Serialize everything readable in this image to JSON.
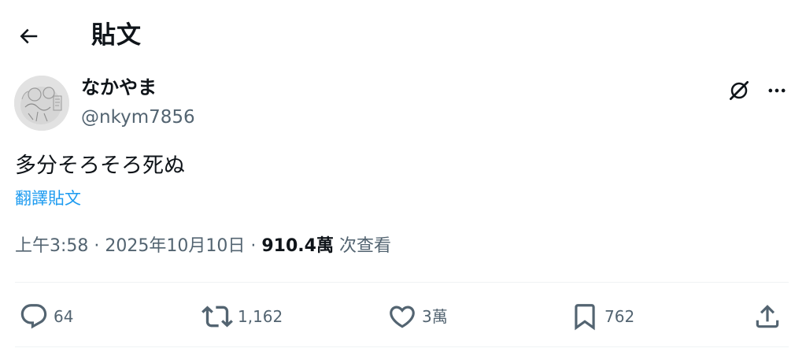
{
  "header": {
    "title": "貼文"
  },
  "author": {
    "display_name": "なかやま",
    "handle": "@nkym7856"
  },
  "tweet": {
    "text": "多分そろそろ死ぬ",
    "translate_label": "翻譯貼文"
  },
  "meta": {
    "time": "上午3:58",
    "separator": " · ",
    "date": "2025年10月10日",
    "views_count": "910.4萬",
    "views_label": "次查看"
  },
  "actions": {
    "replies": "64",
    "reposts": "1,162",
    "likes": "3萬",
    "bookmarks": "762"
  },
  "icons": {
    "back": "arrow-left-icon",
    "grok": "grok-icon",
    "more": "more-horizontal-icon",
    "reply": "reply-bubble-icon",
    "repost": "repost-icon",
    "like": "heart-icon",
    "bookmark": "bookmark-icon",
    "share": "share-upload-icon"
  },
  "colors": {
    "text_primary": "#0f1419",
    "text_secondary": "#536471",
    "link": "#1d9bf0",
    "divider": "#eff3f4"
  }
}
